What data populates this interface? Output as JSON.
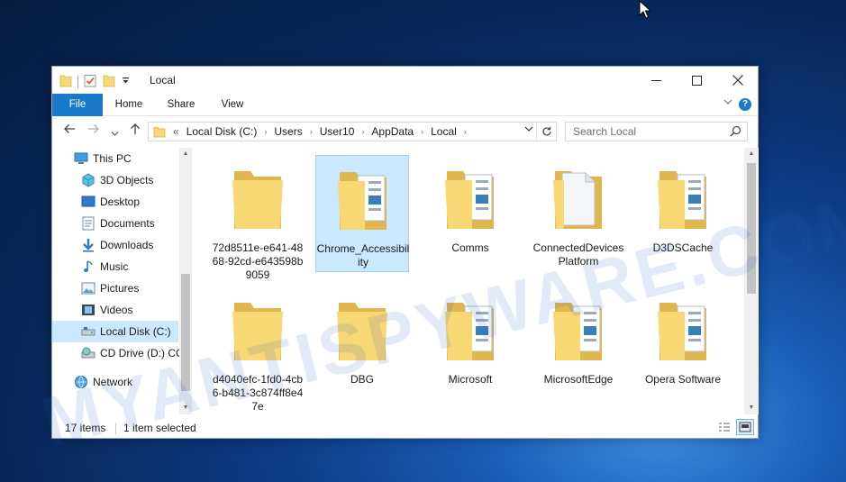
{
  "window": {
    "title": "Local",
    "controls": {
      "minimize": "—",
      "maximize": "☐",
      "close": "✕"
    }
  },
  "ribbon": {
    "tabs": [
      {
        "label": "File"
      },
      {
        "label": "Home"
      },
      {
        "label": "Share"
      },
      {
        "label": "View"
      }
    ],
    "expand_glyph": "⌄",
    "help_glyph": "?"
  },
  "navbar": {
    "back": "🡐",
    "forward": "🡒",
    "recent": "⌄",
    "up": "🡑",
    "breadcrumb_overflow": "«",
    "breadcrumb": [
      "Local Disk (C:)",
      "Users",
      "User10",
      "AppData",
      "Local"
    ],
    "crumb_sep": "›",
    "dropdown": "⌄",
    "refresh": "↻",
    "search_placeholder": "Search Local"
  },
  "nav_pane": {
    "items": [
      {
        "label": "This PC",
        "icon": "computer-icon"
      },
      {
        "label": "3D Objects",
        "icon": "cube-icon"
      },
      {
        "label": "Desktop",
        "icon": "desktop-icon"
      },
      {
        "label": "Documents",
        "icon": "documents-icon"
      },
      {
        "label": "Downloads",
        "icon": "download-arrow-icon"
      },
      {
        "label": "Music",
        "icon": "music-note-icon"
      },
      {
        "label": "Pictures",
        "icon": "pictures-icon"
      },
      {
        "label": "Videos",
        "icon": "film-icon"
      },
      {
        "label": "Local Disk (C:)",
        "icon": "drive-icon",
        "selected": true
      },
      {
        "label": "CD Drive (D:) CC",
        "icon": "cd-drive-icon"
      },
      {
        "label": "Network",
        "icon": "network-icon"
      }
    ]
  },
  "files": [
    {
      "name": "72d8511e-e641-4868-92cd-e643598b9059",
      "kind": "folder-empty"
    },
    {
      "name": "Chrome_Accessibility",
      "kind": "folder-docs",
      "selected": true
    },
    {
      "name": "Comms",
      "kind": "folder-docs"
    },
    {
      "name": "ConnectedDevicesPlatform",
      "kind": "folder-page"
    },
    {
      "name": "D3DSCache",
      "kind": "folder-docs"
    },
    {
      "name": "d4040efc-1fd0-4cb6-b481-3c874ff8e47e",
      "kind": "folder-empty"
    },
    {
      "name": "DBG",
      "kind": "folder-empty"
    },
    {
      "name": "Microsoft",
      "kind": "folder-docs"
    },
    {
      "name": "MicrosoftEdge",
      "kind": "folder-docs"
    },
    {
      "name": "Opera Software",
      "kind": "folder-docs"
    }
  ],
  "status": {
    "item_count": "17 items",
    "selection": "1 item selected"
  },
  "watermark": "MYANTISPYWARE.COM",
  "colors": {
    "accent": "#1979ca",
    "selection": "#cce8ff",
    "folder": "#f8d775",
    "folder_dark": "#e0b64f"
  }
}
